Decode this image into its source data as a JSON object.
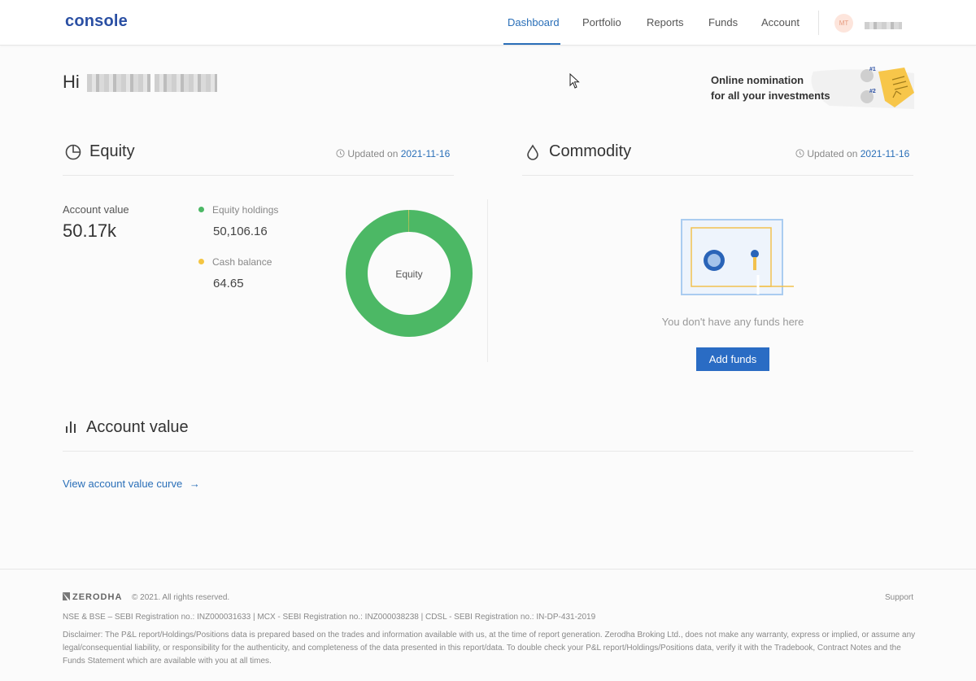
{
  "header": {
    "logo": "console",
    "nav": [
      {
        "label": "Dashboard",
        "active": true
      },
      {
        "label": "Portfolio",
        "active": false
      },
      {
        "label": "Reports",
        "active": false
      },
      {
        "label": "Funds",
        "active": false
      },
      {
        "label": "Account",
        "active": false
      }
    ],
    "avatar_initials": "MT"
  },
  "greeting": {
    "prefix": "Hi"
  },
  "banner": {
    "line1": "Online nomination",
    "line2": "for all your investments",
    "marker1": "#1",
    "marker2": "#2"
  },
  "equity": {
    "title": "Equity",
    "updated_label": "Updated on",
    "updated_date": "2021-11-16",
    "account_value_label": "Account value",
    "account_value": "50.17k",
    "holdings_label": "Equity holdings",
    "holdings_value": "50,106.16",
    "cash_label": "Cash balance",
    "cash_value": "64.65",
    "donut_center": "Equity"
  },
  "commodity": {
    "title": "Commodity",
    "updated_label": "Updated on",
    "updated_date": "2021-11-16",
    "empty_message": "You don't have any funds here",
    "add_funds_label": "Add funds"
  },
  "account_value_section": {
    "title": "Account value",
    "link_label": "View account value curve",
    "link_arrow": "→"
  },
  "footer": {
    "brand": "ZERODHA",
    "copyright": "© 2021. All rights reserved.",
    "support": "Support",
    "registration": "NSE & BSE – SEBI Registration no.: INZ000031633 | MCX - SEBI Registration no.: INZ000038238 | CDSL - SEBI Registration no.: IN-DP-431-2019",
    "disclaimer": "Disclaimer: The P&L report/Holdings/Positions data is prepared based on the trades and information available with us, at the time of report generation. Zerodha Broking Ltd., does not make any warranty, express or implied, or assume any legal/consequential liability, or responsibility for the authenticity, and completeness of the data presented in this report/data. To double check your P&L report/Holdings/Positions data, verify it with the Tradebook, Contract Notes and the Funds Statement which are available with you at all times."
  },
  "colors": {
    "accent": "#2a6fb8",
    "button": "#2a6cc4",
    "equity_green": "#4cb865",
    "cash_yellow": "#f4c542"
  },
  "chart_data": {
    "type": "pie",
    "categories": [
      "Equity holdings",
      "Cash balance"
    ],
    "values": [
      50106.16,
      64.65
    ],
    "title": "",
    "center_label": "Equity"
  }
}
